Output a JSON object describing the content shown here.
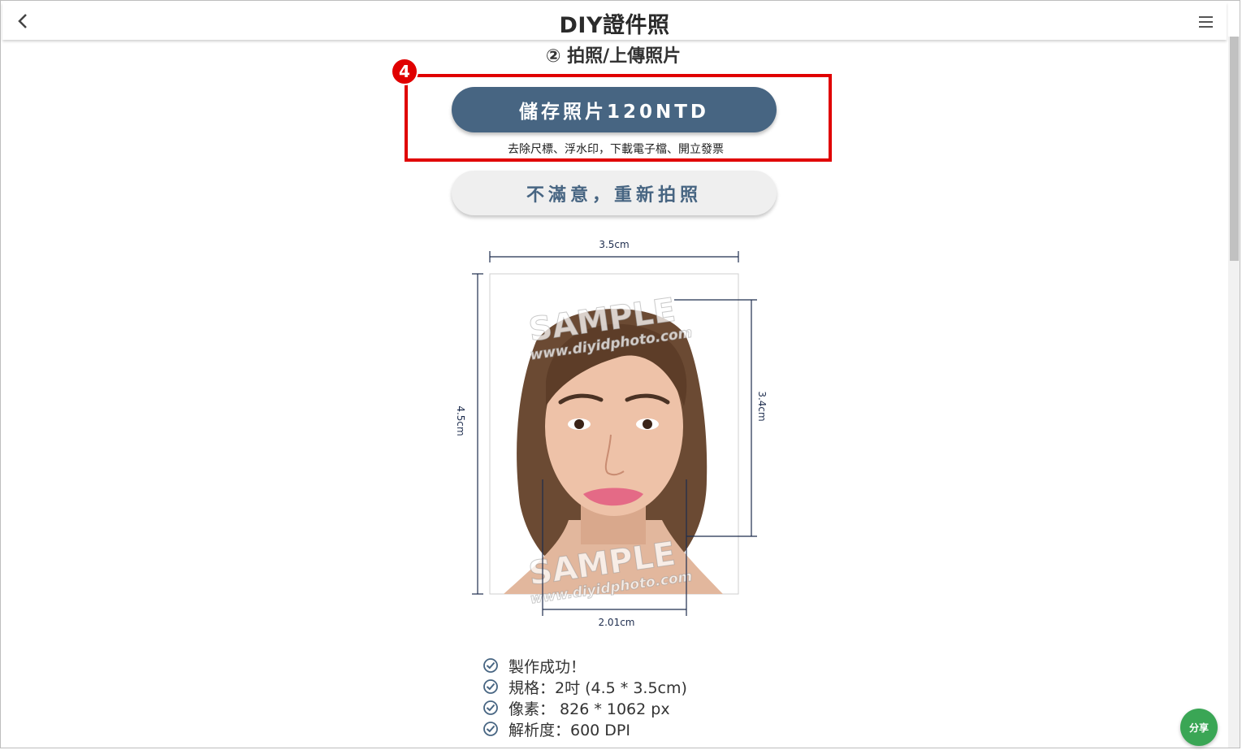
{
  "header": {
    "title": "DIY證件照"
  },
  "step": {
    "title": "② 拍照/上傳照片"
  },
  "annotation": {
    "badge_number": "4",
    "highlight_color": "#e00000"
  },
  "save": {
    "label": "儲存照片120NTD",
    "subtitle": "去除尺標、浮水印，下載電子檔、開立發票",
    "color": "#476582"
  },
  "retake": {
    "label": "不滿意，重新拍照"
  },
  "photo": {
    "width_label": "3.5cm",
    "height_label": "4.5cm",
    "head_height_label": "3.4cm",
    "face_width_label": "2.01cm",
    "watermark_text": "SAMPLE",
    "watermark_url": "www.diyidphoto.com"
  },
  "info": [
    {
      "text": "製作成功！"
    },
    {
      "text": "規格：2吋 (4.5 * 3.5cm)"
    },
    {
      "text": "像素： 826 * 1062 px"
    },
    {
      "text": "解析度：600 DPI"
    }
  ],
  "share": {
    "label": "分享",
    "color": "#3aa655"
  }
}
